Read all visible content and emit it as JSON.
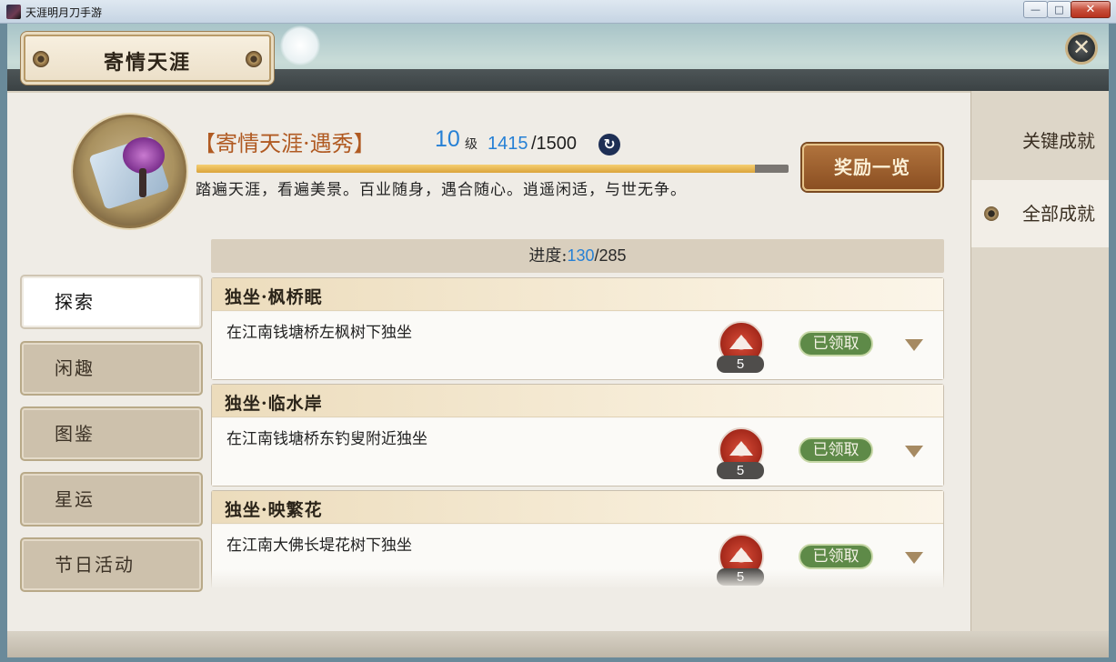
{
  "window": {
    "title": "天涯明月刀手游",
    "close_glyph": "✕",
    "min_glyph": "—",
    "max_glyph": "□"
  },
  "header": {
    "plaque_title": "寄情天涯"
  },
  "achievement": {
    "title": "【寄情天涯·遇秀】",
    "level": "10",
    "level_unit": "级",
    "exp_current": "1415",
    "exp_max": "/1500",
    "exp_fraction": 0.943,
    "description": "踏遍天涯，看遍美景。百业随身，遇合随心。逍遥闲适，与世无争。"
  },
  "reward_button": "奖励一览",
  "progress": {
    "label": "进度:",
    "current": "130",
    "total": "/285"
  },
  "tabs": [
    "探索",
    "闲趣",
    "图鉴",
    "星运",
    "节日活动"
  ],
  "right_tabs": [
    "关键成就",
    "全部成就"
  ],
  "items": [
    {
      "name": "独坐·枫桥眠",
      "desc": "在江南钱塘桥左枫树下独坐",
      "reward_count": "5",
      "status": "已领取"
    },
    {
      "name": "独坐·临水岸",
      "desc": "在江南钱塘桥东钓叟附近独坐",
      "reward_count": "5",
      "status": "已领取"
    },
    {
      "name": "独坐·映繁花",
      "desc": "在江南大佛长堤花树下独坐",
      "reward_count": "5",
      "status": "已领取"
    }
  ],
  "icons": [
    "app-icon",
    "close-icon",
    "refresh-icon",
    "mountain-badge-icon",
    "chevron-down-icon",
    "ornament-icon"
  ]
}
